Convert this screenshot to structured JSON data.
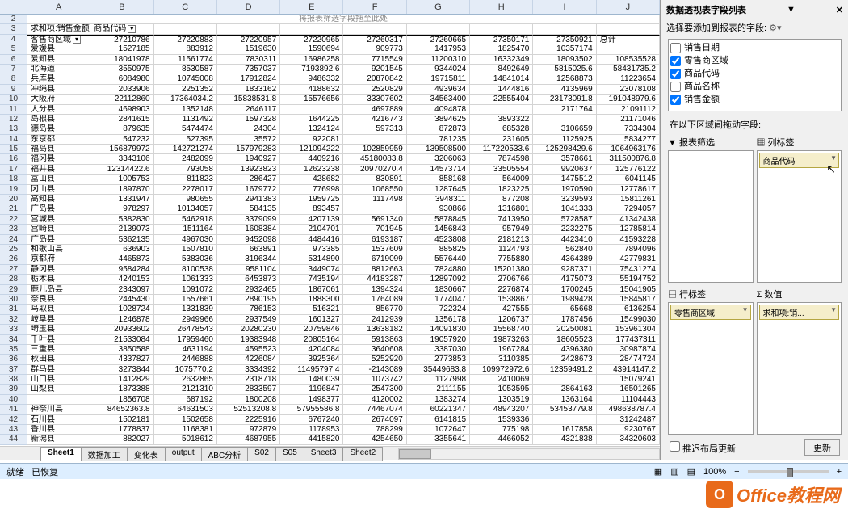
{
  "drop_hint": "将报表筛选字段拖至此处",
  "columns": [
    "A",
    "B",
    "C",
    "D",
    "E",
    "F",
    "G",
    "H",
    "I",
    "J"
  ],
  "row_start": 3,
  "pivot_header": {
    "measure": "求和项:销售金额",
    "col_field": "商品代码",
    "row_field": "客售商区域",
    "total_label": "总计"
  },
  "col_codes": [
    "27210786",
    "27220883",
    "27220957",
    "27220965",
    "27260317",
    "27260665",
    "27350171",
    "27350921"
  ],
  "rows": [
    {
      "label": "爱媛县",
      "vals": [
        "1527185",
        "883912",
        "1519630",
        "1590694",
        "909773",
        "1417953",
        "1825470",
        "10357174"
      ]
    },
    {
      "label": "爱知县",
      "vals": [
        "18041978",
        "11561774",
        "7830311",
        "16986258",
        "7715549",
        "11200310",
        "16332349",
        "18093502",
        "108535528"
      ]
    },
    {
      "label": "北海道",
      "vals": [
        "3550975",
        "8530587",
        "7357037",
        "7193892.6",
        "9201545",
        "9344024",
        "8492649",
        "5815025.6",
        "58431735.2"
      ]
    },
    {
      "label": "兵库县",
      "vals": [
        "6084980",
        "10745008",
        "17912824",
        "9486332",
        "20870842",
        "19715811",
        "14841014",
        "12568873",
        "11223654"
      ]
    },
    {
      "label": "冲绳县",
      "vals": [
        "2033906",
        "2251352",
        "1833162",
        "4188632",
        "2520829",
        "4939634",
        "1444816",
        "4135969",
        "23078108"
      ]
    },
    {
      "label": "大阪府",
      "vals": [
        "22112860",
        "17364034.2",
        "15838531.8",
        "15576656",
        "33307602",
        "34563400",
        "22555404",
        "23173091.8",
        "191048979.6"
      ]
    },
    {
      "label": "大分县",
      "vals": [
        "4698903",
        "1352148",
        "2646117",
        "",
        "4697889",
        "4094878",
        "",
        "2171764",
        "21091112"
      ]
    },
    {
      "label": "岛根县",
      "vals": [
        "2841615",
        "1131492",
        "1597328",
        "1644225",
        "4216743",
        "3894625",
        "3893322",
        "",
        "21171046"
      ]
    },
    {
      "label": "德岛县",
      "vals": [
        "879635",
        "5474474",
        "24304",
        "1324124",
        "597313",
        "872873",
        "685328",
        "3106659",
        "7334304"
      ]
    },
    {
      "label": "东京都",
      "vals": [
        "547232",
        "527395",
        "35572",
        "922081",
        "",
        "781235",
        "231605",
        "1125925",
        "5834277"
      ]
    },
    {
      "label": "福岛县",
      "vals": [
        "156879972",
        "142721274",
        "157979283",
        "121094222",
        "102859959",
        "139508500",
        "117220533.6",
        "125298429.6",
        "1064963176"
      ]
    },
    {
      "label": "福冈县",
      "vals": [
        "3343106",
        "2482099",
        "1940927",
        "4409216",
        "45180083.8",
        "3206063",
        "7874598",
        "3578661",
        "311500876.8"
      ]
    },
    {
      "label": "福井县",
      "vals": [
        "12314422.6",
        "793058",
        "13923823",
        "12623238",
        "20970270.4",
        "14573714",
        "33505554",
        "9920637",
        "125776122"
      ]
    },
    {
      "label": "富山县",
      "vals": [
        "1005753",
        "811823",
        "286427",
        "428682",
        "830891",
        "858168",
        "564009",
        "1475512",
        "6041145"
      ]
    },
    {
      "label": "冈山县",
      "vals": [
        "1897870",
        "2278017",
        "1679772",
        "776998",
        "1068550",
        "1287645",
        "1823225",
        "1970590",
        "12778617"
      ]
    },
    {
      "label": "高知县",
      "vals": [
        "1331947",
        "980655",
        "2941383",
        "1959725",
        "1117498",
        "3948311",
        "877208",
        "3239593",
        "15811261"
      ]
    },
    {
      "label": "广岛县",
      "vals": [
        "978297",
        "10134057",
        "584135",
        "893457",
        "",
        "930866",
        "1316801",
        "1041333",
        "7294057"
      ]
    },
    {
      "label": "宫城县",
      "vals": [
        "5382830",
        "5462918",
        "3379099",
        "4207139",
        "5691340",
        "5878845",
        "7413950",
        "5728587",
        "41342438"
      ]
    },
    {
      "label": "宫崎县",
      "vals": [
        "2139073",
        "1511164",
        "1608384",
        "2104701",
        "701945",
        "1456843",
        "957949",
        "2232275",
        "12785814"
      ]
    },
    {
      "label": "广岛县",
      "vals": [
        "5362135",
        "4967030",
        "9452098",
        "4484416",
        "6193187",
        "4523808",
        "2181213",
        "4423410",
        "41593228"
      ]
    },
    {
      "label": "和歌山县",
      "vals": [
        "636903",
        "1507810",
        "663891",
        "973385",
        "1537609",
        "885825",
        "1124793",
        "562840",
        "7894096"
      ]
    },
    {
      "label": "京都府",
      "vals": [
        "4465873",
        "5383036",
        "3196344",
        "5314890",
        "6719099",
        "5576440",
        "7755880",
        "4364389",
        "42779831"
      ]
    },
    {
      "label": "静冈县",
      "vals": [
        "9584284",
        "8100538",
        "9581104",
        "3449074",
        "8812663",
        "7824880",
        "15201380",
        "9287371",
        "75431274"
      ]
    },
    {
      "label": "栃木县",
      "vals": [
        "4240153",
        "1061333",
        "6453873",
        "7435194",
        "44183287",
        "12897092",
        "2706766",
        "4175073",
        "55194752"
      ]
    },
    {
      "label": "鹿儿岛县",
      "vals": [
        "2343097",
        "1091072",
        "2932465",
        "1867061",
        "1394324",
        "1830667",
        "2276874",
        "1700245",
        "15041905"
      ]
    },
    {
      "label": "奈良县",
      "vals": [
        "2445430",
        "1557661",
        "2890195",
        "1888300",
        "1764089",
        "1774047",
        "1538867",
        "1989428",
        "15845817"
      ]
    },
    {
      "label": "鸟取县",
      "vals": [
        "1028724",
        "1331839",
        "786153",
        "516321",
        "856770",
        "722324",
        "427555",
        "65668",
        "6136254"
      ]
    },
    {
      "label": "岐阜县",
      "vals": [
        "1246878",
        "2949966",
        "2937549",
        "1601327",
        "2412939",
        "1356178",
        "1206737",
        "1787456",
        "15499030"
      ]
    },
    {
      "label": "埼玉县",
      "vals": [
        "20933602",
        "26478543",
        "20280230",
        "20759846",
        "13638182",
        "14091830",
        "15568740",
        "20250081",
        "153961304"
      ]
    },
    {
      "label": "千叶县",
      "vals": [
        "21533084",
        "17959460",
        "19383948",
        "20805164",
        "5913863",
        "19057920",
        "19873263",
        "18605523",
        "177437311"
      ]
    },
    {
      "label": "三重县",
      "vals": [
        "3850588",
        "4631194",
        "4595523",
        "4204084",
        "3640608",
        "3387030",
        "1967284",
        "4396380",
        "30987874"
      ]
    },
    {
      "label": "秋田县",
      "vals": [
        "4337827",
        "2446888",
        "4226084",
        "3925364",
        "5252920",
        "2773853",
        "3110385",
        "2428673",
        "28474724"
      ]
    },
    {
      "label": "群马县",
      "vals": [
        "3273844",
        "1075770.2",
        "3334392",
        "11495797.4",
        "-2143089",
        "35449683.8",
        "109972972.6",
        "12359491.2",
        "43914147.2"
      ]
    },
    {
      "label": "山口县",
      "vals": [
        "1412829",
        "2632865",
        "2318718",
        "1480039",
        "1073742",
        "1127998",
        "2410069",
        "",
        "15079241"
      ]
    },
    {
      "label": "山梨县",
      "vals": [
        "1873388",
        "2121310",
        "2833597",
        "1196847",
        "2547300",
        "2111155",
        "1053595",
        "2864163",
        "16501265"
      ]
    },
    {
      "label": "",
      "vals": [
        "1856708",
        "687192",
        "1800208",
        "1498377",
        "4120002",
        "1383274",
        "1303519",
        "1363164",
        "11104443"
      ]
    },
    {
      "label": "神奈川县",
      "vals": [
        "84652363.8",
        "64631503",
        "52513208.8",
        "57955586.8",
        "74467074",
        "60221347",
        "48943207",
        "53453779.8",
        "498638787.4"
      ]
    },
    {
      "label": "石川县",
      "vals": [
        "1502181",
        "1502658",
        "2225916",
        "6767240",
        "2674097",
        "6141815",
        "1539336",
        "",
        "31242487"
      ]
    },
    {
      "label": "香川县",
      "vals": [
        "1778837",
        "1168381",
        "972879",
        "1178953",
        "788299",
        "1072647",
        "775198",
        "1617858",
        "9230767"
      ]
    },
    {
      "label": "新潟县",
      "vals": [
        "882027",
        "5018612",
        "4687955",
        "4415820",
        "4254650",
        "3355641",
        "4466052",
        "4321838",
        "34320603"
      ]
    }
  ],
  "sheet_tabs": [
    "Sheet1",
    "数据加工",
    "变化表",
    "output",
    "ABC分析",
    "S02",
    "S05",
    "Sheet3",
    "Sheet2"
  ],
  "active_tab": 0,
  "pivot_pane": {
    "title": "数据透视表字段列表",
    "prompt": "选择要添加到报表的字段:",
    "fields": [
      {
        "name": "销售日期",
        "checked": false
      },
      {
        "name": "零售商区域",
        "checked": true
      },
      {
        "name": "商品代码",
        "checked": true
      },
      {
        "name": "商品名称",
        "checked": false
      },
      {
        "name": "销售金额",
        "checked": true
      }
    ],
    "area_prompt": "在以下区域间拖动字段:",
    "areas": {
      "filter_label": "▼ 报表筛选",
      "columns_label": "▦ 列标签",
      "rows_label": "▤ 行标签",
      "values_label": "Σ 数值",
      "columns_chip": "商品代码",
      "rows_chip": "零售商区域",
      "values_chip": "求和项:销..."
    },
    "defer_label": "推迟布局更新",
    "update_btn": "更新"
  },
  "statusbar": {
    "left1": "就绪",
    "left2": "已恢复",
    "zoom": "100%"
  },
  "watermark": "Office教程网"
}
